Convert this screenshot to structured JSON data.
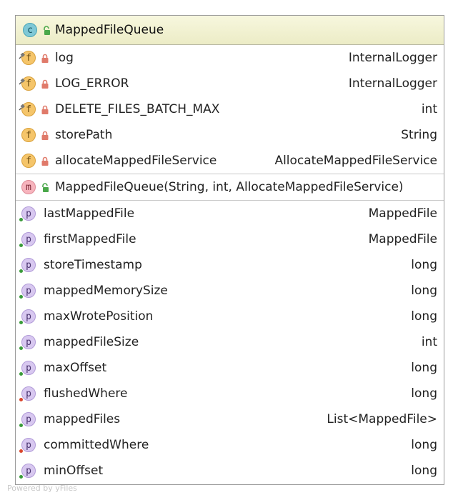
{
  "class": {
    "name": "MappedFileQueue",
    "icon": "class-icon",
    "kind_letter": "c"
  },
  "fields": [
    {
      "name": "log",
      "type": "InternalLogger",
      "letter": "f",
      "static": true,
      "access": "private"
    },
    {
      "name": "LOG_ERROR",
      "type": "InternalLogger",
      "letter": "f",
      "static": true,
      "access": "private"
    },
    {
      "name": "DELETE_FILES_BATCH_MAX",
      "type": "int",
      "letter": "f",
      "static": true,
      "access": "private"
    },
    {
      "name": "storePath",
      "type": "String",
      "letter": "f",
      "static": false,
      "access": "private"
    },
    {
      "name": "allocateMappedFileService",
      "type": "AllocateMappedFileService",
      "letter": "f",
      "static": false,
      "access": "private"
    }
  ],
  "constructors": [
    {
      "signature": "MappedFileQueue(String, int, AllocateMappedFileService)",
      "letter": "m",
      "access": "public"
    }
  ],
  "properties": [
    {
      "name": "lastMappedFile",
      "type": "MappedFile",
      "letter": "p",
      "marker": "green"
    },
    {
      "name": "firstMappedFile",
      "type": "MappedFile",
      "letter": "p",
      "marker": "green"
    },
    {
      "name": "storeTimestamp",
      "type": "long",
      "letter": "p",
      "marker": "green"
    },
    {
      "name": "mappedMemorySize",
      "type": "long",
      "letter": "p",
      "marker": "green"
    },
    {
      "name": "maxWrotePosition",
      "type": "long",
      "letter": "p",
      "marker": "green"
    },
    {
      "name": "mappedFileSize",
      "type": "int",
      "letter": "p",
      "marker": "green"
    },
    {
      "name": "maxOffset",
      "type": "long",
      "letter": "p",
      "marker": "green"
    },
    {
      "name": "flushedWhere",
      "type": "long",
      "letter": "p",
      "marker": "red"
    },
    {
      "name": "mappedFiles",
      "type": "List<MappedFile>",
      "letter": "p",
      "marker": "green"
    },
    {
      "name": "committedWhere",
      "type": "long",
      "letter": "p",
      "marker": "red"
    },
    {
      "name": "minOffset",
      "type": "long",
      "letter": "p",
      "marker": "green"
    }
  ],
  "watermark": "Powered by yFiles",
  "colors": {
    "header_bg": "#ececc6",
    "field_icon": "#f5c56a",
    "property_icon": "#d8c8f0",
    "method_icon": "#f7b4bd",
    "class_icon": "#7fc8d6",
    "lock_private": "#e07a6a",
    "lock_public": "#4aa84a"
  }
}
